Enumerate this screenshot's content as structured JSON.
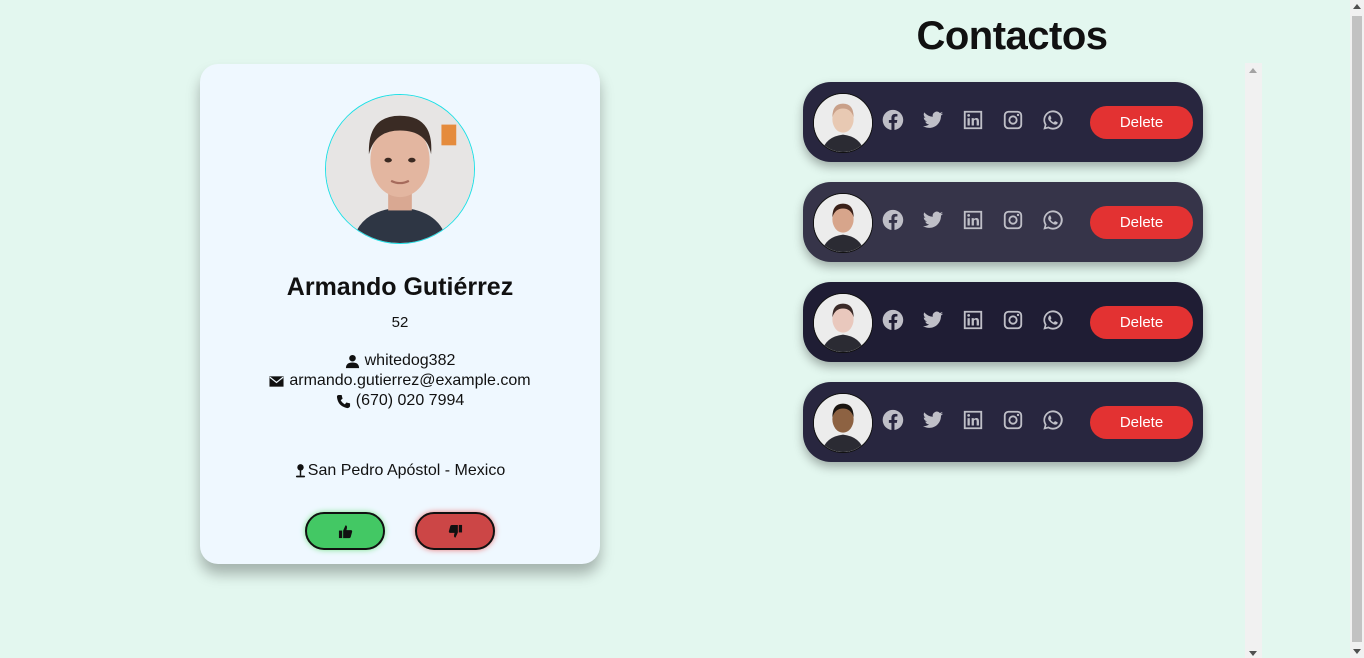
{
  "profile": {
    "name": "Armando Gutiérrez",
    "age": "52",
    "username": "whitedog382",
    "email": "armando.gutierrez@example.com",
    "phone": "(670) 020 7994",
    "location": "San Pedro Apóstol - Mexico",
    "icons": {
      "user": "user-icon",
      "email": "envelope-icon",
      "phone": "phone-icon",
      "location": "map-pin-icon",
      "like": "thumbs-up-icon",
      "dislike": "thumbs-down-icon"
    }
  },
  "contacts_title": "Contactos",
  "contacts": [
    {
      "delete_label": "Delete",
      "bg": "#28263f",
      "skin": "#e8c9b3",
      "hair": "#c9a089"
    },
    {
      "delete_label": "Delete",
      "bg": "#363449",
      "skin": "#d7a58b",
      "hair": "#3a2018"
    },
    {
      "delete_label": "Delete",
      "bg": "#1f1d34",
      "skin": "#e9c8bd",
      "hair": "#3a2a28"
    },
    {
      "delete_label": "Delete",
      "bg": "#28263f",
      "skin": "#8d6242",
      "hair": "#1a1410"
    }
  ],
  "social_icons": [
    "facebook-icon",
    "twitter-icon",
    "linkedin-icon",
    "instagram-icon",
    "whatsapp-icon"
  ],
  "colors": {
    "background": "#e3f7ef",
    "card": "#eff8ff",
    "delete": "#e33232",
    "like": "#43c864",
    "dislike": "#cc4646",
    "avatar_border": "#1ee0e6"
  }
}
